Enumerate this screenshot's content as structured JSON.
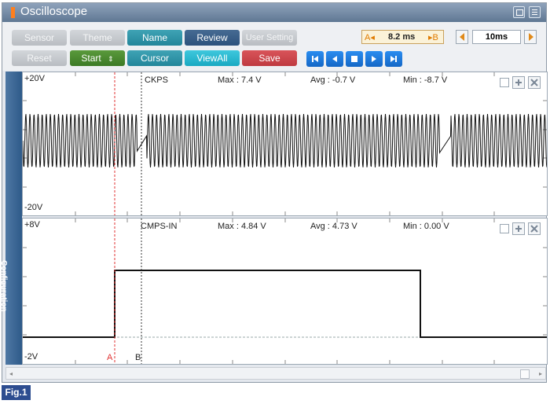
{
  "window": {
    "title": "Oscilloscope"
  },
  "toolbar": {
    "row1": {
      "sensor": "Sensor",
      "theme": "Theme",
      "name": "Name",
      "review": "Review",
      "user_setting": "User Setting"
    },
    "row2": {
      "reset": "Reset",
      "start": "Start",
      "cursor": "Cursor",
      "viewall": "ViewAll",
      "save": "Save"
    },
    "cursor_interval": {
      "a_label": "A",
      "value": "8.2 ms",
      "b_label": "B"
    },
    "time_div": "10ms"
  },
  "sidebar": {
    "label": "Configuration"
  },
  "panels": [
    {
      "top_label": "+20V",
      "bottom_label": "-20V",
      "name": "CKPS",
      "max": "Max : 7.4 V",
      "avg": "Avg : -0.7 V",
      "min": "Min : -8.7 V"
    },
    {
      "top_label": "+8V",
      "bottom_label": "-2V",
      "name": "CMPS-IN",
      "max": "Max : 4.84 V",
      "avg": "Avg : 4.73 V",
      "min": "Min : 0.00 V"
    }
  ],
  "cursors": {
    "a": "A",
    "b": "B"
  },
  "figure_label": "Fig.1",
  "colors": {
    "titlebar": "#6b829e",
    "accent_orange": "#ff7f1e",
    "cursor_a": "#e03030",
    "cursor_b": "#333333",
    "figure_badge": "#2d4d90"
  }
}
